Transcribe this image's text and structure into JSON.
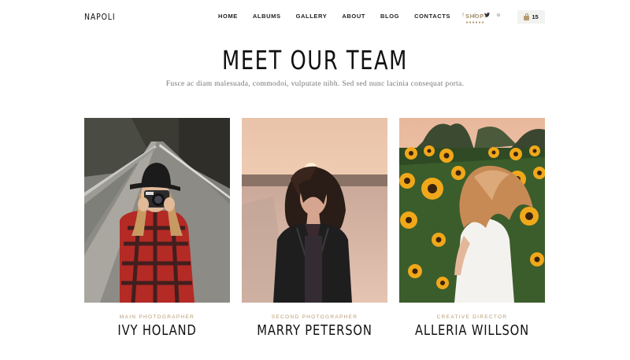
{
  "header": {
    "logo": "NAPOLI",
    "nav": [
      "HOME",
      "ALBUMS",
      "GALLERY",
      "ABOUT",
      "BLOG",
      "CONTACTS",
      "SHOP"
    ],
    "active_nav": "SHOP",
    "socials": [
      "facebook-icon",
      "pinterest-icon",
      "twitter-icon",
      "dribbble-icon"
    ],
    "social_glyphs": [
      "f",
      "p",
      "t",
      "⊕"
    ],
    "cart_count": "15"
  },
  "hero": {
    "title": "MEET OUR TEAM",
    "subtitle": "Fusce ac diam malesuada, commodoi, vulputate nibh. Sed sed nunc lacinia consequat porta."
  },
  "team": [
    {
      "role": "MAIN PHOTOGRAPHER",
      "name": "IVY HOLAND"
    },
    {
      "role": "SECOND PHOTOGRAPHER",
      "name": "MARRY PETERSON"
    },
    {
      "role": "CREATIVE DIRECTOR",
      "name": "ALLERIA WILLSON"
    }
  ],
  "colors": {
    "accent": "#b79a70",
    "text": "#111111",
    "muted": "#777777"
  }
}
